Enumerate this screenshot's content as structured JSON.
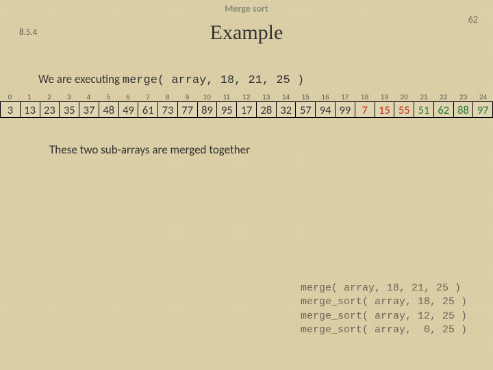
{
  "header": {
    "title": "Merge sort",
    "page_number": "62"
  },
  "section_number": "8.5.4",
  "main_title": "Example",
  "body_line_prefix": "We are executing ",
  "body_line_code": "merge( array, 18, 21, 25 )",
  "array": {
    "indices": [
      "0",
      "1",
      "2",
      "3",
      "4",
      "5",
      "6",
      "7",
      "8",
      "9",
      "10",
      "11",
      "12",
      "13",
      "14",
      "15",
      "16",
      "17",
      "18",
      "19",
      "20",
      "21",
      "22",
      "23",
      "24"
    ],
    "values": [
      "3",
      "13",
      "23",
      "35",
      "37",
      "48",
      "49",
      "61",
      "73",
      "77",
      "89",
      "95",
      "17",
      "28",
      "32",
      "57",
      "94",
      "99",
      "7",
      "15",
      "55",
      "51",
      "62",
      "88",
      "97"
    ],
    "highlight_a": [
      18,
      19,
      20
    ],
    "highlight_b": [
      21,
      22,
      23,
      24
    ]
  },
  "sub_text": "These two sub-arrays are merged together",
  "callstack": [
    "merge( array, 18, 21, 25 )",
    "merge_sort( array, 18, 25 )",
    "merge_sort( array, 12, 25 )",
    "merge_sort( array,  0, 25 )"
  ]
}
